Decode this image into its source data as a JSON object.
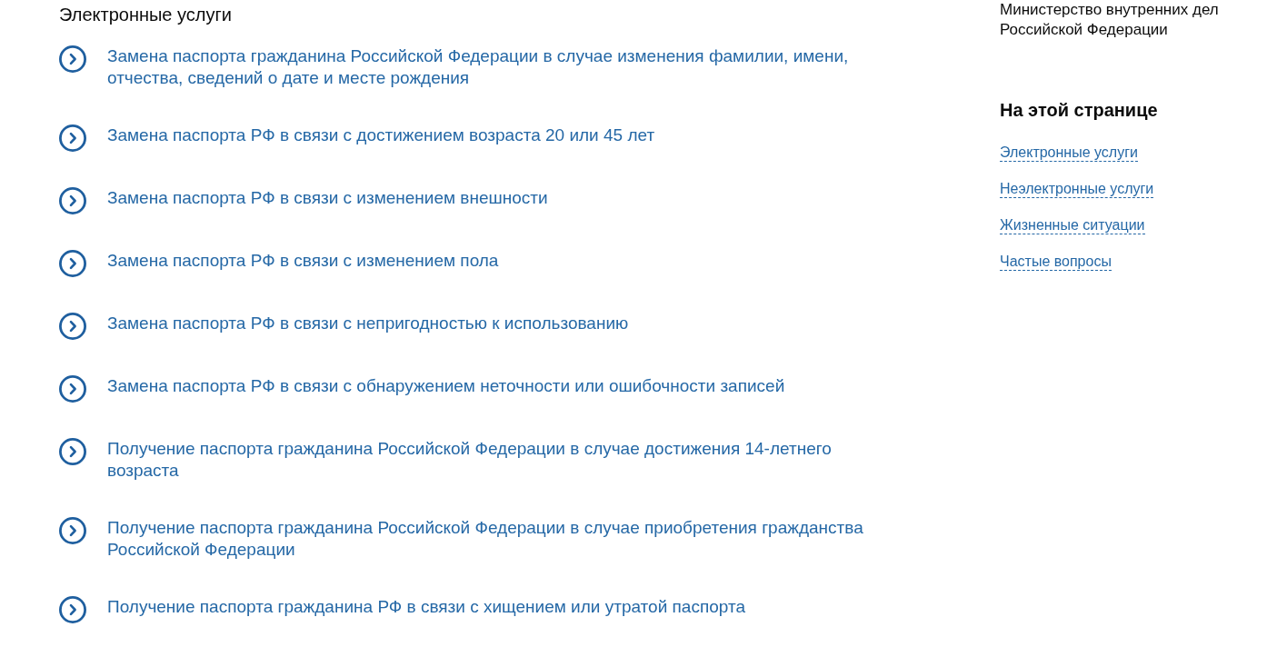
{
  "section_title": "Электронные услуги",
  "services": [
    {
      "title": "Замена паспорта гражданина Российской Федерации в случае изменения фамилии, имени, отчества, сведений о дате и месте рождения"
    },
    {
      "title": "Замена паспорта РФ в связи с достижением возраста 20 или 45 лет"
    },
    {
      "title": "Замена паспорта РФ в связи с изменением внешности"
    },
    {
      "title": "Замена паспорта РФ в связи с изменением пола"
    },
    {
      "title": "Замена паспорта РФ в связи с непригодностью к использованию"
    },
    {
      "title": "Замена паспорта РФ в связи с обнаружением неточности или ошибочности записей"
    },
    {
      "title": "Получение паспорта гражданина Российской Федерации в случае достижения 14-летнего возраста"
    },
    {
      "title": "Получение паспорта гражданина Российской Федерации в случае приобретения гражданства Российской Федерации"
    },
    {
      "title": "Получение паспорта гражданина РФ в связи с хищением или утратой паспорта"
    }
  ],
  "agency": {
    "name": "Министерство внутренних дел Российской Федерации"
  },
  "on_this_page": {
    "title": "На этой странице",
    "links": [
      "Электронные услуги",
      "Неэлектронные услуги",
      "Жизненные ситуации",
      "Частые вопросы"
    ]
  }
}
